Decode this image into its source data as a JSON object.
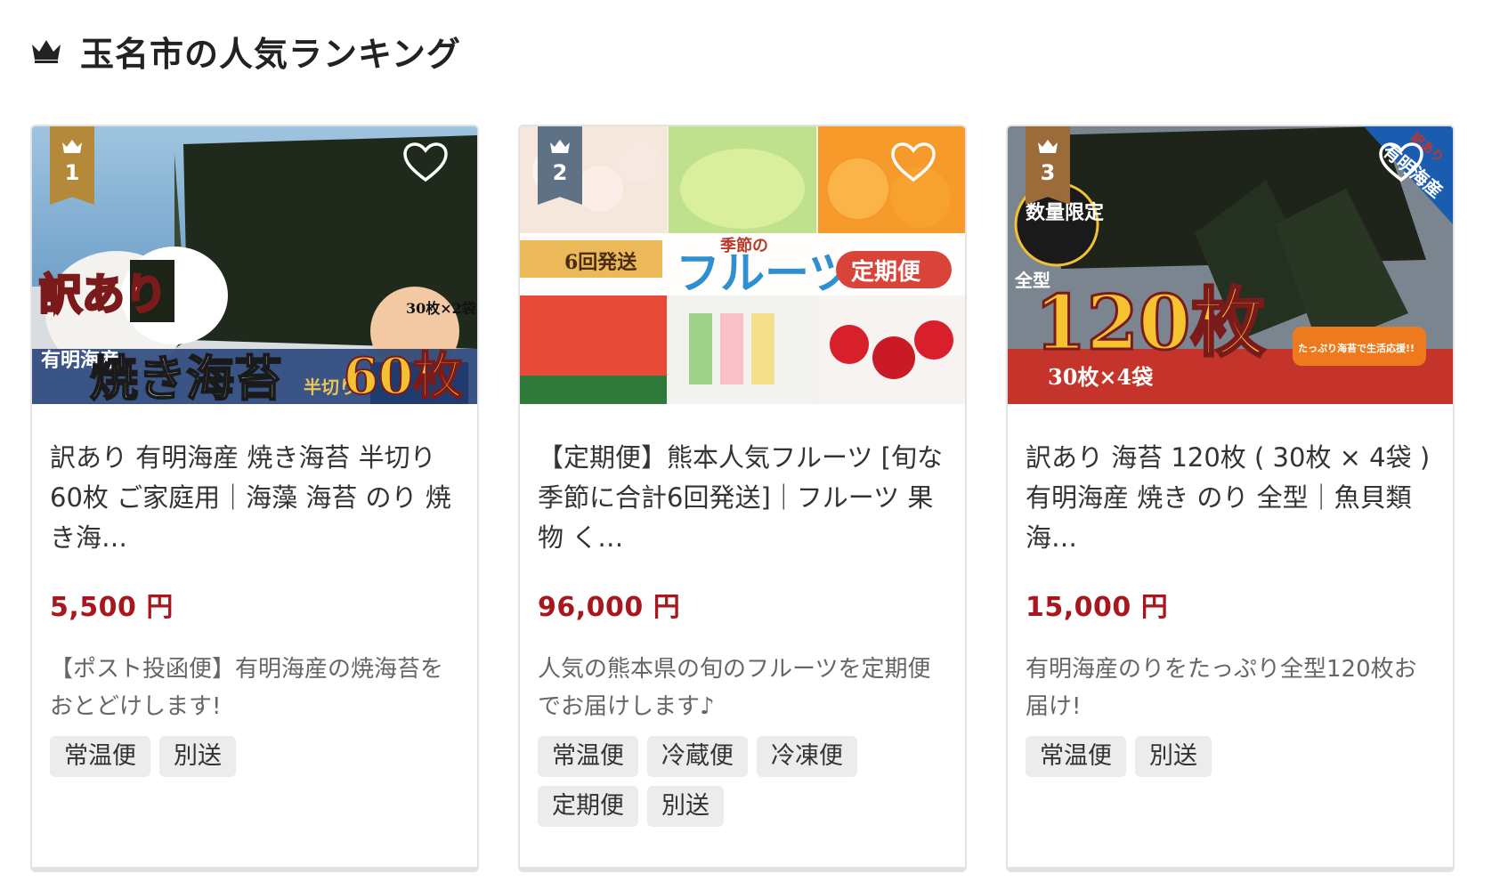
{
  "section": {
    "title": "玉名市の人気ランキング",
    "icon": "crown-icon"
  },
  "colors": {
    "price": "#a8171d",
    "rank1_badge": "#b5893a",
    "rank2_badge": "#5f7184",
    "rank3_badge": "#9c6b3a",
    "tag_background": "#ececec",
    "card_border": "#e2e2e2"
  },
  "cards": [
    {
      "rank": "1",
      "image_text": {
        "line1": "訳あり",
        "line2": "有明海産",
        "line3": "焼き海苔",
        "line4": "半切り",
        "line5": "60枚",
        "line6": "30枚×2袋"
      },
      "title": "訳あり 有明海産 焼き海苔 半切り 60枚 ご家庭用｜海藻 海苔 のり 焼き海…",
      "price": "5,500 円",
      "description": "【ポスト投函便】有明海産の焼海苔をおとどけします!",
      "tags": [
        "常温便",
        "別送"
      ]
    },
    {
      "rank": "2",
      "image_text": {
        "line1": "6回発送",
        "line2": "季節の",
        "line3": "フルーツ",
        "line4": "定期便"
      },
      "title": "【定期便】熊本人気フルーツ [旬な季節に合計6回発送]｜フルーツ 果物 く…",
      "price": "96,000 円",
      "description": "人気の熊本県の旬のフルーツを定期便でお届けします♪",
      "tags": [
        "常温便",
        "冷蔵便",
        "冷凍便",
        "定期便",
        "別送"
      ]
    },
    {
      "rank": "3",
      "image_text": {
        "line1": "数量限定",
        "line2": "全型",
        "line3": "120枚",
        "line4": "30枚×4袋",
        "line5": "有明海産",
        "line6": "訳あり",
        "line7": "たっぷり海苔で生活応援!!"
      },
      "title": "訳あり 海苔 120枚 ( 30枚 × 4袋 ) 有明海産 焼き のり 全型｜魚貝類 海…",
      "price": "15,000 円",
      "description": "有明海産のりをたっぷり全型120枚お届け!",
      "tags": [
        "常温便",
        "別送"
      ]
    }
  ]
}
